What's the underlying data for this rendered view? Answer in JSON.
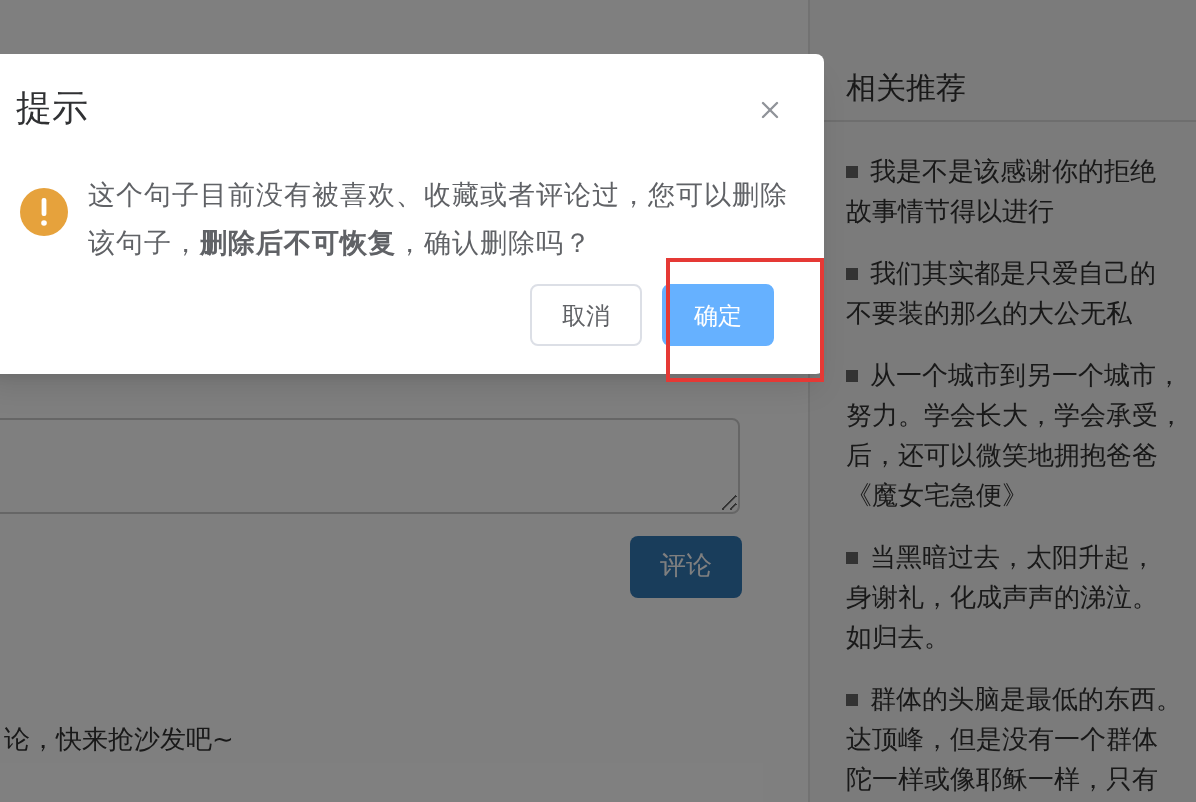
{
  "dialog": {
    "title": "提示",
    "message": "这个句子目前没有被喜欢、收藏或者评论过，您可以删除该句子，**删除后不可恢复**，确认删除吗？",
    "buttons": [
      {
        "label": "取消",
        "kind": "default"
      },
      {
        "label": "确定",
        "kind": "primary"
      }
    ]
  },
  "comment_form": {
    "submit": "评论"
  },
  "empty_comments": "论，快来抢沙发吧~",
  "sidebar": {
    "title": "相关推荐",
    "items": [
      {
        "lines": [
          "我是不是该感谢你的拒绝",
          "故事情节得以进行"
        ]
      },
      {
        "lines": [
          "我们其实都是只爱自己的",
          "不要装的那么的大公无私"
        ]
      },
      {
        "lines": [
          "从一个城市到另一个城市，",
          "努力。学会长大，学会承受，",
          "后，还可以微笑地拥抱爸爸",
          "《魔女宅急便》"
        ]
      },
      {
        "lines": [
          "当黑暗过去，太阳升起，",
          "身谢礼，化成声声的涕泣。",
          "如归去。"
        ]
      },
      {
        "lines": [
          "群体的头脑是最低的东西。",
          "达顶峰，但是没有一个群体",
          "陀一样或像耶稣一样，只有"
        ]
      }
    ]
  }
}
